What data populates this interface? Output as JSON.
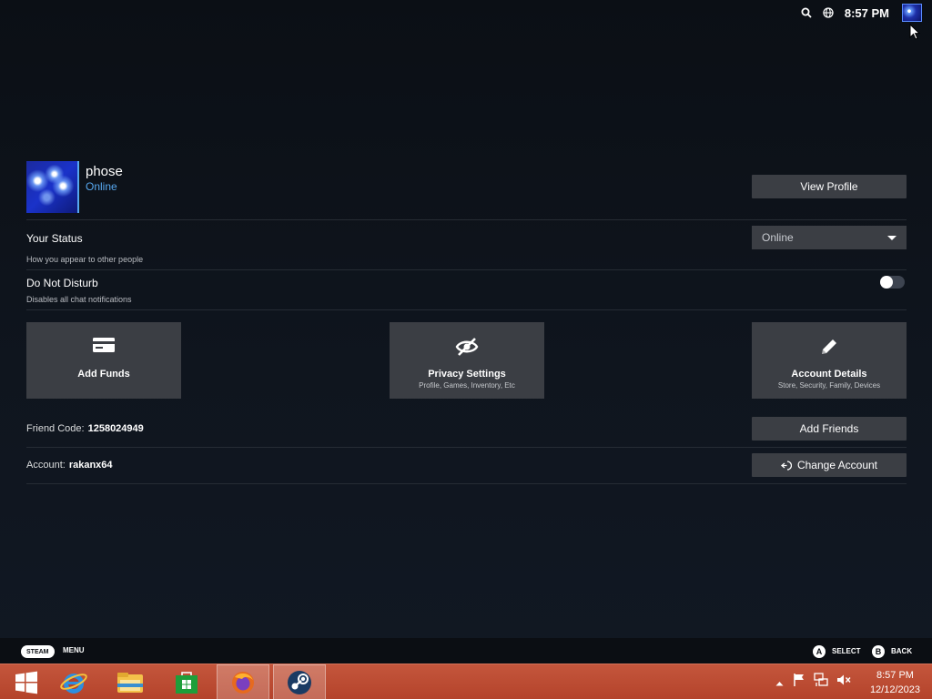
{
  "topbar": {
    "clock": "8:57 PM",
    "icons": [
      "search-icon",
      "globe-icon"
    ]
  },
  "profile": {
    "name": "phose",
    "status": "Online",
    "view_profile_label": "View Profile"
  },
  "status_row": {
    "title": "Your Status",
    "subtitle": "How you appear to other people",
    "selected": "Online"
  },
  "dnd_row": {
    "title": "Do Not Disturb",
    "subtitle": "Disables all chat notifications",
    "enabled": false
  },
  "tiles": [
    {
      "label": "Add Funds",
      "sub": "",
      "icon": "credit-card-icon"
    },
    {
      "label": "Privacy Settings",
      "sub": "Profile, Games, Inventory, Etc",
      "icon": "eye-off-icon"
    },
    {
      "label": "Account Details",
      "sub": "Store, Security, Family, Devices",
      "icon": "pencil-icon"
    }
  ],
  "friend_code": {
    "label": "Friend Code:",
    "value": "1258024949",
    "button": "Add Friends"
  },
  "account": {
    "label": "Account:",
    "value": "rakanx64",
    "button": "Change Account"
  },
  "footer": {
    "steam": "STEAM",
    "menu": "MENU",
    "a_key": "A",
    "select": "SELECT",
    "b_key": "B",
    "back": "BACK"
  },
  "taskbar": {
    "apps": [
      "windows-start",
      "internet-explorer",
      "file-explorer",
      "windows-store",
      "firefox",
      "steam"
    ],
    "time": "8:57 PM",
    "date": "12/12/2023"
  },
  "colors": {
    "accent": "#57a8f0",
    "panel": "#3b3e44",
    "taskbar": "#b4432b"
  }
}
